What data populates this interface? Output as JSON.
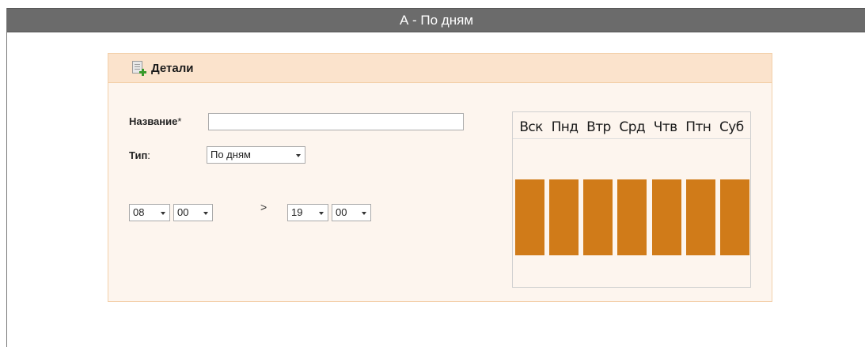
{
  "window": {
    "title": "А - По дням"
  },
  "panel": {
    "title": "Детали",
    "icon": "document-add-icon",
    "name_label": "Название",
    "required_mark": "*",
    "name_value": "",
    "type_label": "Тип",
    "type_colon": ":",
    "type_value": "По дням",
    "time_from": {
      "hour": "08",
      "minute": "00"
    },
    "separator": ">",
    "time_to": {
      "hour": "19",
      "minute": "00"
    }
  },
  "week": {
    "days": [
      "Вск",
      "Пнд",
      "Втр",
      "Срд",
      "Чтв",
      "Птн",
      "Суб"
    ],
    "active": [
      true,
      true,
      true,
      true,
      true,
      true,
      true
    ],
    "active_color": "#d07b19"
  },
  "colors": {
    "titlebar": "#6b6b6b",
    "panel_bg": "#fdf5ee",
    "panel_header_bg": "#fbe3cc",
    "panel_border": "#f3cfa9"
  }
}
